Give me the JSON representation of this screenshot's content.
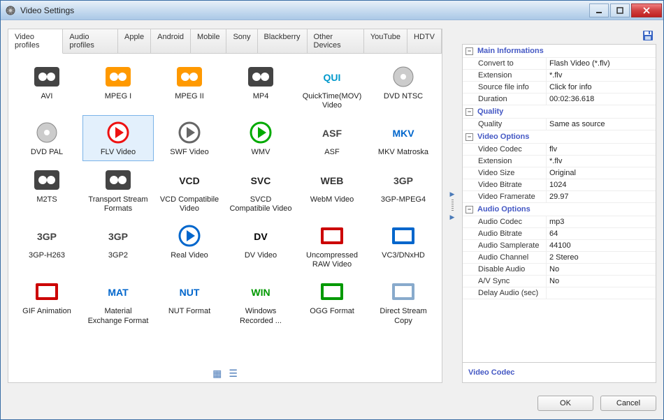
{
  "window": {
    "title": "Video Settings"
  },
  "tabs": [
    "Video profiles",
    "Audio profiles",
    "Apple",
    "Android",
    "Mobile",
    "Sony",
    "Blackberry",
    "Other Devices",
    "YouTube",
    "HDTV"
  ],
  "active_tab": 0,
  "formats": [
    {
      "label": "AVI"
    },
    {
      "label": "MPEG I"
    },
    {
      "label": "MPEG II"
    },
    {
      "label": "MP4"
    },
    {
      "label": "QuickTime(MOV) Video"
    },
    {
      "label": "DVD NTSC"
    },
    {
      "label": "DVD PAL"
    },
    {
      "label": "FLV Video",
      "selected": true
    },
    {
      "label": "SWF Video"
    },
    {
      "label": "WMV"
    },
    {
      "label": "ASF"
    },
    {
      "label": "MKV Matroska"
    },
    {
      "label": "M2TS"
    },
    {
      "label": "Transport Stream Formats"
    },
    {
      "label": "VCD Compatibile Video"
    },
    {
      "label": "SVCD Compatibile Video"
    },
    {
      "label": "WebM Video"
    },
    {
      "label": "3GP-MPEG4"
    },
    {
      "label": "3GP-H263"
    },
    {
      "label": "3GP2"
    },
    {
      "label": "Real Video"
    },
    {
      "label": "DV Video"
    },
    {
      "label": "Uncompressed RAW Video"
    },
    {
      "label": "VC3/DNxHD"
    },
    {
      "label": "GIF Animation"
    },
    {
      "label": "Material Exchange Format"
    },
    {
      "label": "NUT Format"
    },
    {
      "label": "Windows Recorded ..."
    },
    {
      "label": "OGG Format"
    },
    {
      "label": "Direct Stream Copy"
    }
  ],
  "groups": [
    {
      "title": "Main Informations",
      "rows": [
        {
          "key": "Convert to",
          "val": "Flash Video (*.flv)"
        },
        {
          "key": "Extension",
          "val": "*.flv"
        },
        {
          "key": "Source file info",
          "val": "Click for info"
        },
        {
          "key": "Duration",
          "val": "00:02:36.618"
        }
      ]
    },
    {
      "title": "Quality",
      "rows": [
        {
          "key": "Quality",
          "val": "Same as source"
        }
      ]
    },
    {
      "title": "Video Options",
      "rows": [
        {
          "key": "Video Codec",
          "val": "flv"
        },
        {
          "key": "Extension",
          "val": "*.flv"
        },
        {
          "key": "Video Size",
          "val": "Original"
        },
        {
          "key": "Video Bitrate",
          "val": "1024"
        },
        {
          "key": "Video Framerate",
          "val": "29.97"
        }
      ]
    },
    {
      "title": "Audio Options",
      "rows": [
        {
          "key": "Audio Codec",
          "val": "mp3"
        },
        {
          "key": "Audio Bitrate",
          "val": "64"
        },
        {
          "key": "Audio Samplerate",
          "val": "44100"
        },
        {
          "key": "Audio Channel",
          "val": "2 Stereo"
        },
        {
          "key": "Disable Audio",
          "val": "No"
        },
        {
          "key": "A/V Sync",
          "val": "No"
        },
        {
          "key": "Delay Audio (sec)",
          "val": ""
        }
      ]
    }
  ],
  "hint": "Video Codec",
  "buttons": {
    "ok": "OK",
    "cancel": "Cancel"
  }
}
